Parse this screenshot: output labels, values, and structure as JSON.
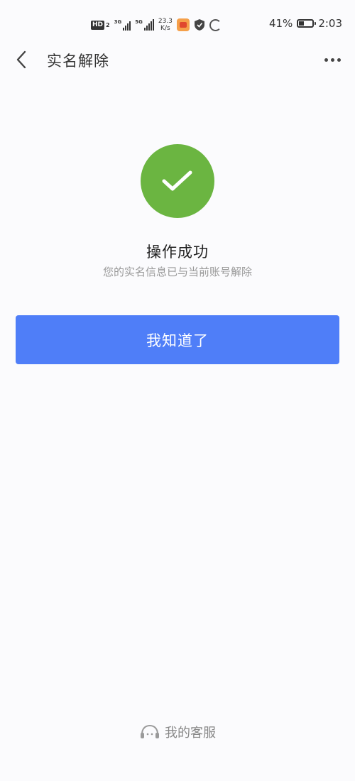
{
  "status_bar": {
    "hd_label": "HD",
    "hd_sub": "2",
    "net1_label": "3G",
    "net2_label": "5G",
    "speed_value": "23.3",
    "speed_unit": "K/s",
    "battery_percent": "41%",
    "battery_level": 0.41,
    "time": "2:03"
  },
  "header": {
    "title": "实名解除"
  },
  "result": {
    "title": "操作成功",
    "description": "您的实名信息已与当前账号解除",
    "status_color": "#6bb541"
  },
  "actions": {
    "confirm_label": "我知道了",
    "accent_color": "#4f7ef8"
  },
  "footer": {
    "service_label": "我的客服"
  },
  "icons": {
    "back": "chevron-left-icon",
    "more": "more-dots-icon",
    "success": "checkmark-icon",
    "service": "customer-service-icon"
  }
}
